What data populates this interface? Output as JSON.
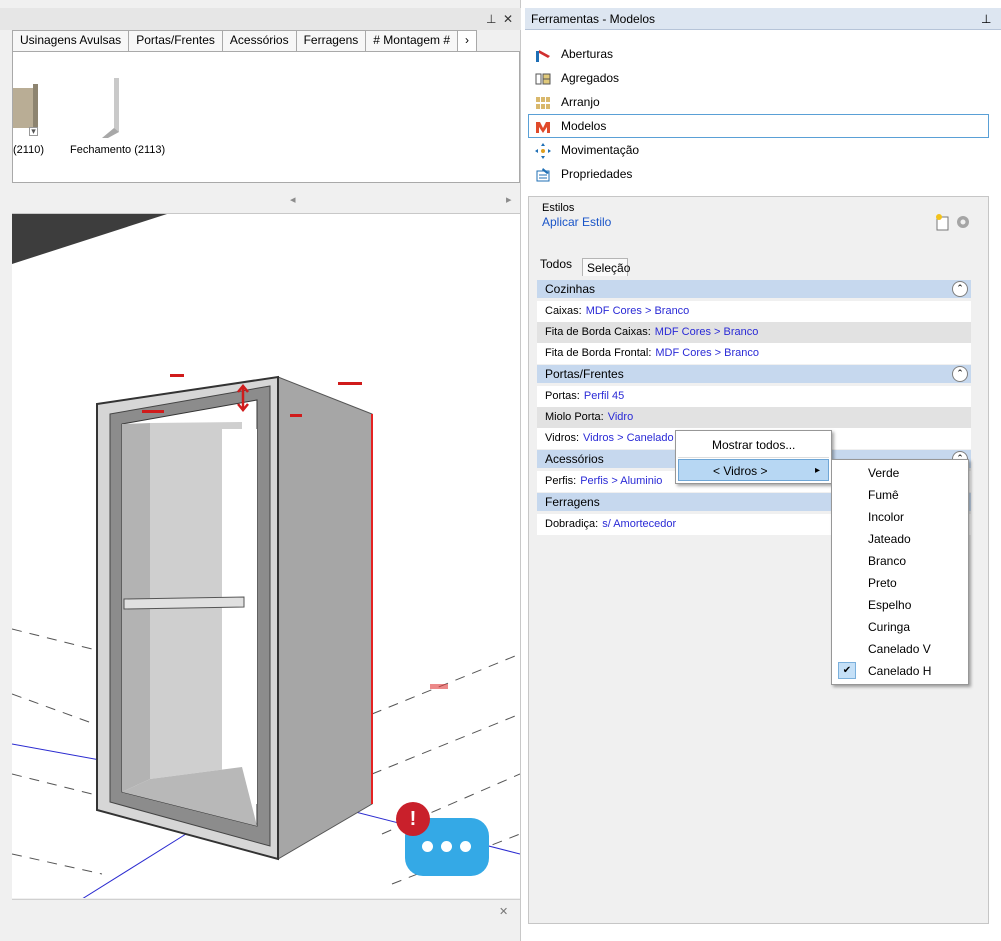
{
  "left": {
    "titlebar": {
      "pin": "⊥",
      "close": "✕"
    },
    "tabs": [
      "Usinagens Avulsas",
      "Portas/Frentes",
      "Acessórios",
      "Ferragens",
      "# Montagem #"
    ],
    "tab_scroll": "›",
    "components": [
      {
        "label": "(2110)"
      },
      {
        "label": "Fechamento (2113)"
      }
    ],
    "scroll_left": "◂",
    "scroll_right": "▸",
    "status_close": "✕"
  },
  "right": {
    "title": "Ferramentas - Modelos",
    "pin": "⊥",
    "tools": [
      {
        "label": "Aberturas",
        "icon": "aberturas-icon"
      },
      {
        "label": "Agregados",
        "icon": "agregados-icon"
      },
      {
        "label": "Arranjo",
        "icon": "arranjo-icon"
      },
      {
        "label": "Modelos",
        "icon": "modelos-icon",
        "selected": true
      },
      {
        "label": "Movimentação",
        "icon": "movimentacao-icon"
      },
      {
        "label": "Propriedades",
        "icon": "propriedades-icon"
      }
    ],
    "estilos": {
      "label": "Estilos",
      "apply_link": "Aplicar Estilo",
      "tabs": [
        "Todos",
        "Seleção"
      ],
      "groups": [
        {
          "title": "Cozinhas",
          "rows": [
            {
              "name": "Caixas:",
              "value": "MDF Cores > Branco"
            },
            {
              "name": "Fita de Borda Caixas:",
              "value": "MDF Cores > Branco"
            },
            {
              "name": "Fita de Borda Frontal:",
              "value": "MDF Cores > Branco"
            }
          ]
        },
        {
          "title": "Portas/Frentes",
          "rows": [
            {
              "name": "Portas:",
              "value": "Perfil 45"
            },
            {
              "name": "Miolo Porta:",
              "value": "Vidro"
            },
            {
              "name": "Vidros:",
              "value": "Vidros > Canelado H"
            }
          ]
        },
        {
          "title": "Acessórios",
          "rows": [
            {
              "name": "Perfis:",
              "value": "Perfis > Aluminio"
            }
          ]
        },
        {
          "title": "Ferragens",
          "rows": [
            {
              "name": "Dobradiça:",
              "value": "s/ Amortecedor"
            }
          ]
        }
      ],
      "collapse_glyph": "⌃"
    }
  },
  "context_menu": {
    "items": [
      "Mostrar todos...",
      "< Vidros >"
    ],
    "submenu_arrow": "▸"
  },
  "submenu": {
    "items": [
      "Verde",
      "Fumê",
      "Incolor",
      "Jateado",
      "Branco",
      "Preto",
      "Espelho",
      "Curinga",
      "Canelado V",
      "Canelado H"
    ],
    "checked": "Canelado H",
    "check_glyph": "✔"
  },
  "chat": {
    "alert": "!"
  }
}
